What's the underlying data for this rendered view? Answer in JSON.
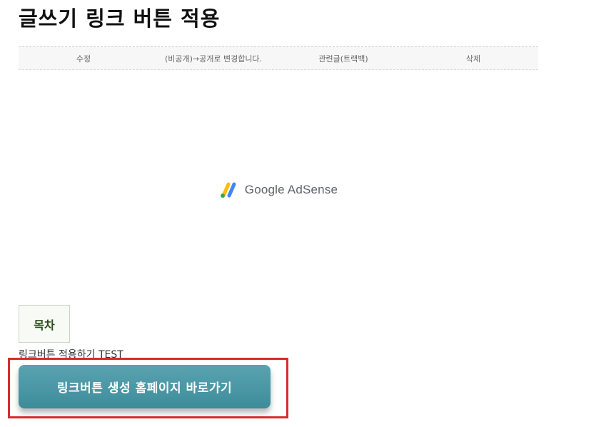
{
  "post": {
    "title": "글쓰기 링크 버튼 적용"
  },
  "actions": [
    {
      "label": "수정"
    },
    {
      "label": "(비공개)→공개로 변경합니다."
    },
    {
      "label": "관련글(트랙백)"
    },
    {
      "label": "삭제"
    }
  ],
  "ad": {
    "logo_icon": "google-adsense-icon",
    "text": "Google AdSense",
    "colors": {
      "yellow": "#fbbc04",
      "green": "#34a853",
      "blue": "#4285f4"
    }
  },
  "toc": {
    "label": "목차",
    "items": [
      {
        "label": "링크버튼 적용하기 TEST"
      }
    ]
  },
  "link_button": {
    "label": "링크버튼 생성 홈페이지 바로가기",
    "color": "#4a96a4"
  },
  "highlight": {
    "color": "#d42d2d"
  }
}
